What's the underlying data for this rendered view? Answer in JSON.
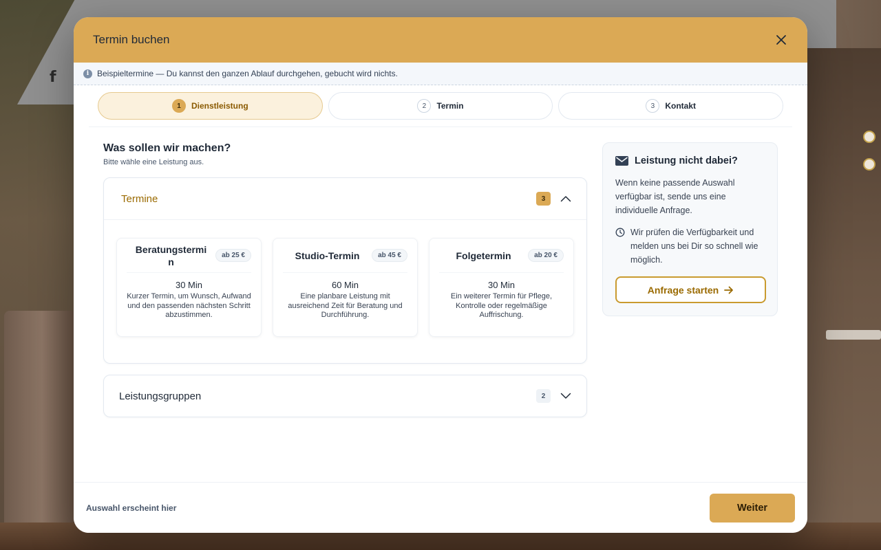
{
  "background": {
    "social_icon": "f"
  },
  "modal": {
    "title": "Termin buchen",
    "notice": "Beispieltermine — Du kannst den ganzen Ablauf durchgehen, gebucht wird nichts."
  },
  "steps": [
    {
      "num": "1",
      "label": "Dienstleistung",
      "active": true
    },
    {
      "num": "2",
      "label": "Termin",
      "active": false
    },
    {
      "num": "3",
      "label": "Kontakt",
      "active": false
    }
  ],
  "main": {
    "title": "Was sollen wir machen?",
    "subtitle": "Bitte wähle eine Leistung aus.",
    "group1": {
      "title": "Termine",
      "count": "3",
      "cards": [
        {
          "name": "Beratungstermi\nn",
          "price": "ab 25 €",
          "duration": "30 Min",
          "desc": "Kurzer Termin, um Wunsch, Aufwand und den passenden nächsten Schritt abzustimmen."
        },
        {
          "name": "Studio-Termin",
          "price": "ab 45 €",
          "duration": "60 Min",
          "desc": "Eine planbare Leistung mit ausreichend Zeit für Beratung und Durchführung."
        },
        {
          "name": "Folgetermin",
          "price": "ab 20 €",
          "duration": "30 Min",
          "desc": "Ein weiterer Termin für Pflege, Kontrolle oder regelmäßige Auffrischung."
        }
      ]
    },
    "group2": {
      "title": "Leistungsgruppen",
      "count": "2"
    }
  },
  "side": {
    "title": "Leistung nicht dabei?",
    "text": "Wenn keine passende Auswahl verfügbar ist, sende uns eine individuelle Anfrage.",
    "hint": "Wir prüfen die Verfügbarkeit und melden uns bei Dir so schnell wie möglich.",
    "cta": "Anfrage starten"
  },
  "footer": {
    "selection": "Auswahl erscheint hier",
    "next": "Weiter"
  },
  "colors": {
    "accent": "#dba955",
    "accent_text": "#9a6a00"
  },
  "icons": [
    "close-icon",
    "info-icon",
    "chevron-up-icon",
    "chevron-down-icon",
    "mail-icon",
    "clock-icon",
    "arrow-right-icon",
    "facebook-icon"
  ]
}
